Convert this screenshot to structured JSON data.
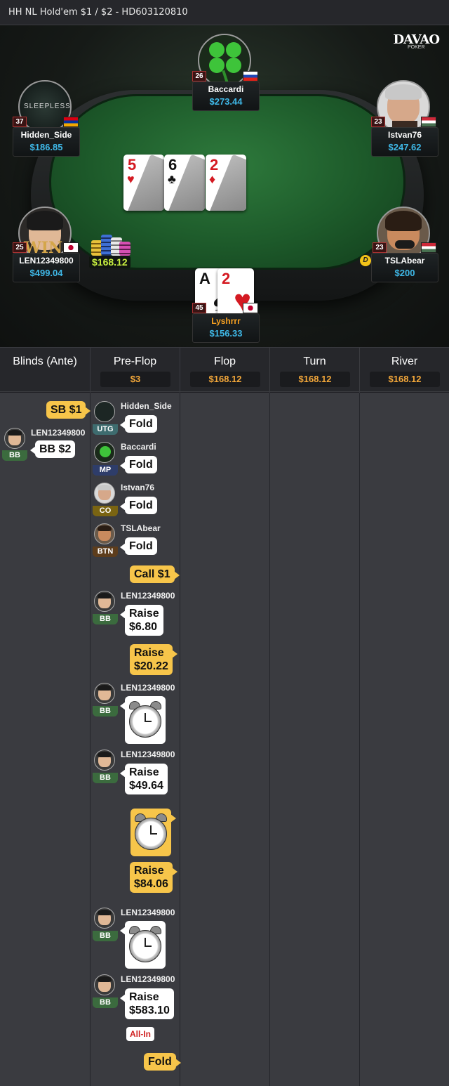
{
  "window": {
    "title": "HH NL Hold'em $1 / $2   - HD603120810"
  },
  "logo": {
    "brand": "DAVAO",
    "sub": "POKER"
  },
  "board": {
    "cards": [
      {
        "rank": "5",
        "suit": "♥",
        "color": "#d41a22"
      },
      {
        "rank": "6",
        "suit": "♣",
        "color": "#111111"
      },
      {
        "rank": "2",
        "suit": "♦",
        "color": "#d41a22"
      }
    ],
    "pot": "$168.12"
  },
  "hero_cards": [
    {
      "rank": "A",
      "suit": "♠",
      "color": "#111111"
    },
    {
      "rank": "2",
      "suit": "♥",
      "color": "#d41a22"
    }
  ],
  "players": [
    {
      "id": "baccardi",
      "name": "Baccardi",
      "stack": "$273.44",
      "level": "26",
      "flag": "si"
    },
    {
      "id": "hidden_side",
      "name": "Hidden_Side",
      "stack": "$186.85",
      "level": "37",
      "flag": "am",
      "avatar_text": "SLEEPLESS"
    },
    {
      "id": "istvan76",
      "name": "Istvan76",
      "stack": "$247.62",
      "level": "23",
      "flag": "hu"
    },
    {
      "id": "len",
      "name": "LEN12349800",
      "stack": "$499.04",
      "level": "25",
      "flag": "jp",
      "avatar_text": "WIN"
    },
    {
      "id": "tslabear",
      "name": "TSLAbear",
      "stack": "$200",
      "level": "23",
      "flag": "hu",
      "dealer": "D"
    },
    {
      "id": "lyshrrr",
      "name": "Lyshrrr",
      "stack": "$156.33",
      "level": "45",
      "flag": "jp"
    }
  ],
  "streets": [
    {
      "label": "Blinds (Ante)",
      "pot": ""
    },
    {
      "label": "Pre-Flop",
      "pot": "$3"
    },
    {
      "label": "Flop",
      "pot": "$168.12"
    },
    {
      "label": "Turn",
      "pot": "$168.12"
    },
    {
      "label": "River",
      "pot": "$168.12"
    }
  ],
  "history": {
    "sb": {
      "label": "SB  $1"
    },
    "bb": {
      "player": "LEN12349800",
      "pos": "BB",
      "label": "BB  $2"
    },
    "preflop": {
      "a1": {
        "player": "Hidden_Side",
        "pos": "UTG",
        "action": "Fold"
      },
      "a2": {
        "player": "Baccardi",
        "pos": "MP",
        "action": "Fold"
      },
      "a3": {
        "player": "Istvan76",
        "pos": "CO",
        "action": "Fold"
      },
      "a4": {
        "player": "TSLAbear",
        "pos": "BTN",
        "action": "Fold"
      },
      "h1": {
        "action": "Call  $1"
      },
      "a5": {
        "player": "LEN12349800",
        "pos": "BB",
        "action": "Raise",
        "amount": "$6.80"
      },
      "h2": {
        "action": "Raise",
        "amount": "$20.22"
      },
      "a6": {
        "player": "LEN12349800",
        "pos": "BB",
        "icon": "alarm-clock"
      },
      "a7": {
        "player": "LEN12349800",
        "pos": "BB",
        "action": "Raise",
        "amount": "$49.64"
      },
      "h3": {
        "icon": "alarm-clock"
      },
      "h4": {
        "action": "Raise",
        "amount": "$84.06"
      },
      "a8": {
        "player": "LEN12349800",
        "pos": "BB",
        "icon": "alarm-clock"
      },
      "a9": {
        "player": "LEN12349800",
        "pos": "BB",
        "action": "Raise",
        "amount": "$583.10",
        "tag": "All-In"
      },
      "h5": {
        "action": "Fold"
      }
    }
  },
  "colors": {
    "stack": "#3fb9e8",
    "hero_name": "#f7a020",
    "pot": "#c8f040",
    "street_pot": "#f4a83a",
    "hero_bubble": "#f7c54a"
  }
}
